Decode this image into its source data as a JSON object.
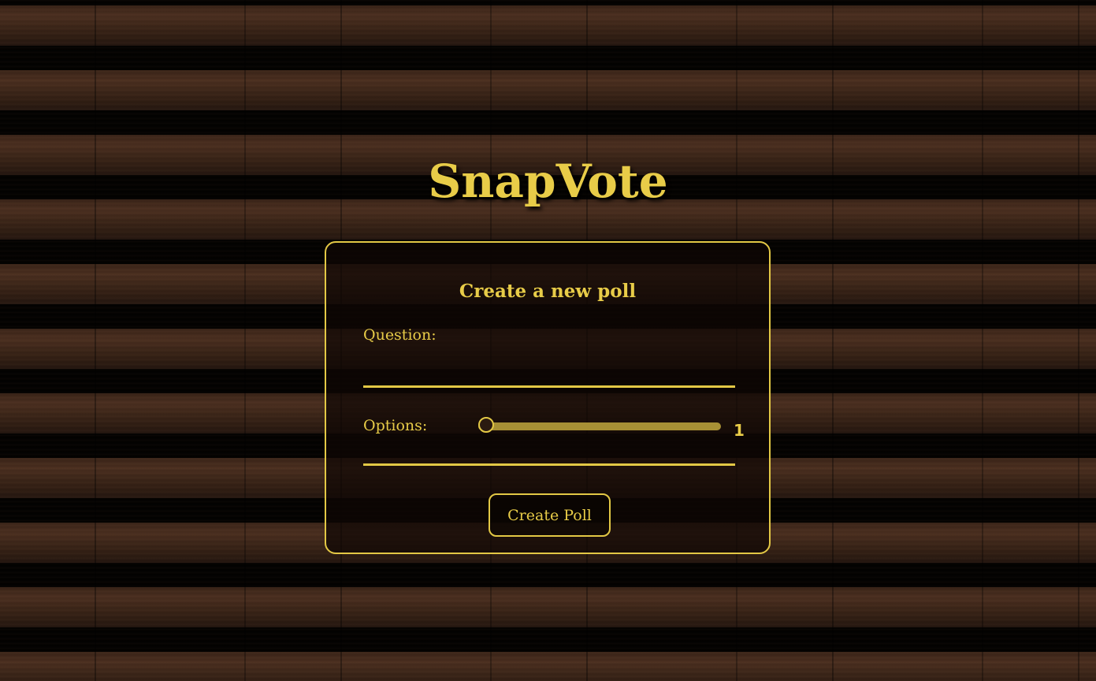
{
  "app": {
    "title": "SnapVote"
  },
  "form": {
    "heading": "Create a new poll",
    "question_label": "Question:",
    "question_value": "",
    "options_label": "Options:",
    "options_count": "1",
    "options_slider_fraction": 0,
    "submit_label": "Create Poll"
  },
  "colors": {
    "accent": "#e8cc48",
    "slider_track": "#a79035",
    "background": "#2e1c12"
  }
}
